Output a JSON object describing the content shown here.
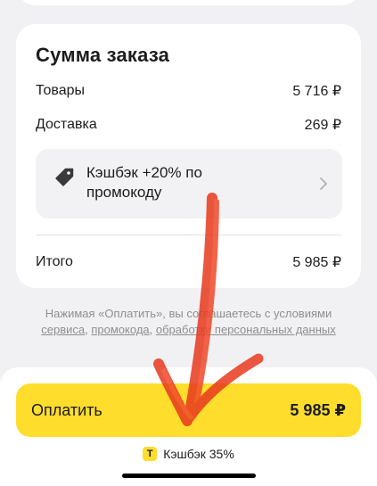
{
  "summary": {
    "title": "Сумма заказа",
    "goods_label": "Товары",
    "goods_value": "5 716 ₽",
    "delivery_label": "Доставка",
    "delivery_value": "269 ₽",
    "promo_text": "Кэшбэк +20% по промокоду",
    "total_label": "Итого",
    "total_value": "5 985 ₽"
  },
  "terms": {
    "prefix": "Нажимая «Оплатить», вы соглашаетесь с условиями",
    "link_service": "сервиса",
    "sep1": ", ",
    "link_promo": "промокода",
    "sep2": ", ",
    "link_data": "обработки персональных данных"
  },
  "payment": {
    "button_label": "Оплатить",
    "amount": "5 985 ₽"
  },
  "cashback": {
    "badge": "Т",
    "text": "Кэшбэк 35%"
  },
  "colors": {
    "accent": "#ffdd2d",
    "annotation": "#e8391e"
  },
  "icons": {
    "promo": "price-tag-icon",
    "chevron": "chevron-right-icon"
  }
}
